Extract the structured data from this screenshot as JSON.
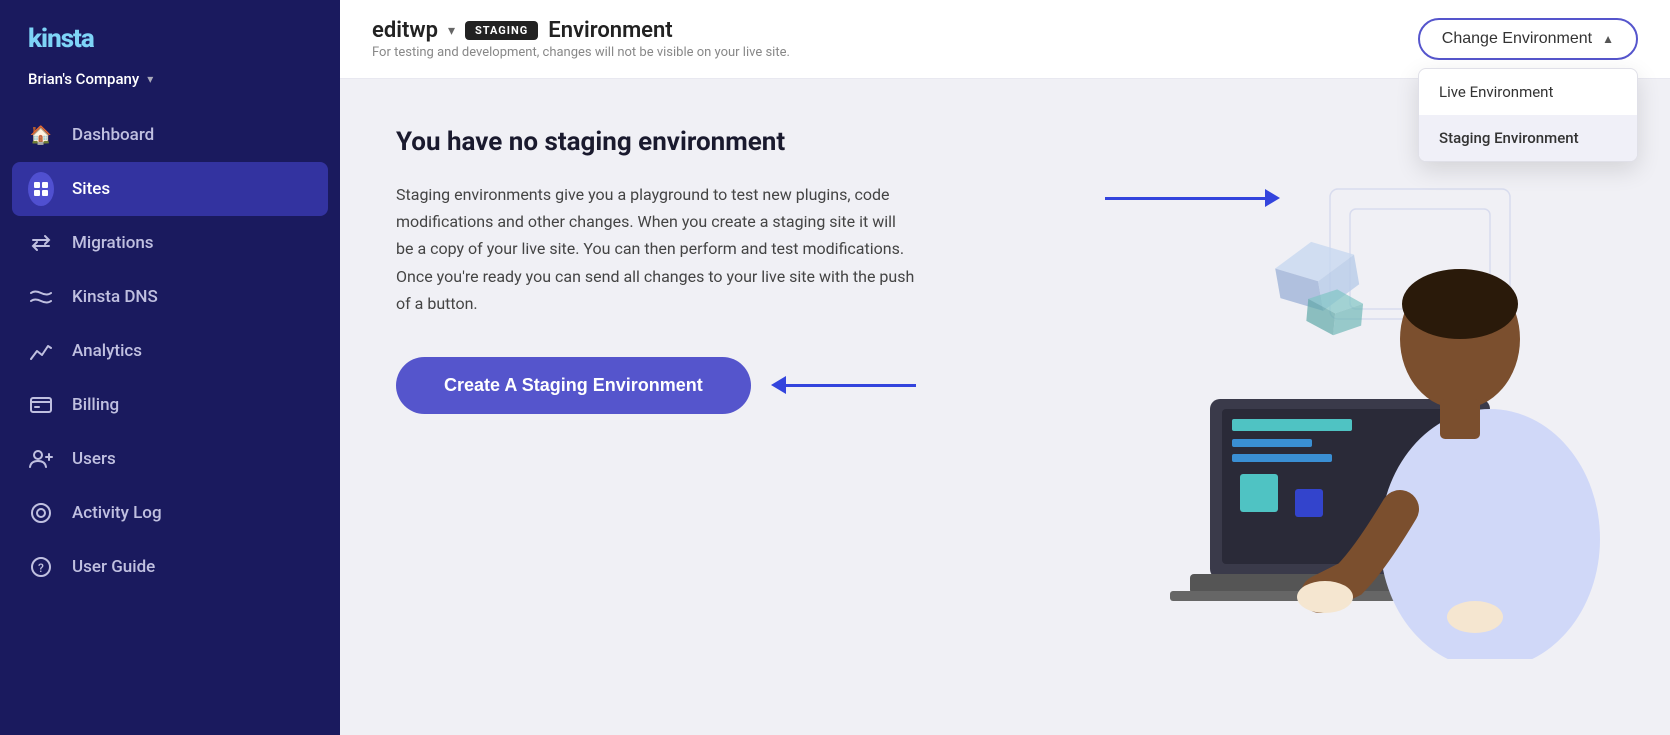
{
  "sidebar": {
    "logo": "kinsta",
    "company": "Brian's Company",
    "nav_items": [
      {
        "id": "dashboard",
        "label": "Dashboard",
        "icon": "🏠",
        "active": false
      },
      {
        "id": "sites",
        "label": "Sites",
        "icon": "◈",
        "active": true
      },
      {
        "id": "migrations",
        "label": "Migrations",
        "icon": "➤",
        "active": false
      },
      {
        "id": "kinsta-dns",
        "label": "Kinsta DNS",
        "icon": "⟺",
        "active": false
      },
      {
        "id": "analytics",
        "label": "Analytics",
        "icon": "📈",
        "active": false
      },
      {
        "id": "billing",
        "label": "Billing",
        "icon": "⊟",
        "active": false
      },
      {
        "id": "users",
        "label": "Users",
        "icon": "👤+",
        "active": false
      },
      {
        "id": "activity-log",
        "label": "Activity Log",
        "icon": "👁",
        "active": false
      },
      {
        "id": "user-guide",
        "label": "User Guide",
        "icon": "?",
        "active": false
      }
    ]
  },
  "header": {
    "site_name": "editwp",
    "badge_text": "STAGING",
    "env_label": "Environment",
    "subtitle": "For testing and development, changes will not be visible on your live site.",
    "change_env_btn": "Change Environment",
    "dropdown": {
      "items": [
        {
          "label": "Live Environment",
          "selected": false
        },
        {
          "label": "Staging Environment",
          "selected": true
        }
      ]
    }
  },
  "content": {
    "title": "You have no staging environment",
    "description": "Staging environments give you a playground to test new plugins, code modifications and other changes. When you create a staging site it will be a copy of your live site. You can then perform and test modifications. Once you're ready you can send all changes to your live site with the push of a button.",
    "create_btn": "Create A Staging Environment"
  },
  "colors": {
    "sidebar_bg": "#1a1a5e",
    "active_nav": "#3333a0",
    "primary": "#5555cc",
    "arrow": "#3344dd"
  }
}
